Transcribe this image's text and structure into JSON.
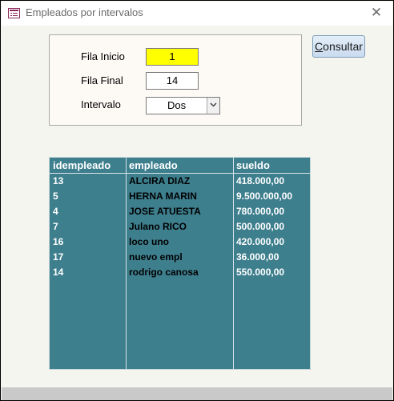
{
  "window": {
    "title": "Empleados por intervalos"
  },
  "form": {
    "fila_inicio_label": "Fila Inicio",
    "fila_inicio_value": "1",
    "fila_final_label": "Fila Final",
    "fila_final_value": "14",
    "intervalo_label": "Intervalo",
    "intervalo_value": "Dos"
  },
  "consultar_button": {
    "accel": "C",
    "rest": "onsultar"
  },
  "table": {
    "headers": [
      "idempleado",
      "empleado",
      "sueldo"
    ],
    "rows": [
      [
        "13",
        "ALCIRA DIAZ",
        "418.000,00"
      ],
      [
        "5",
        "HERNA MARIN",
        "9.500.000,00"
      ],
      [
        "4",
        "JOSE ATUESTA",
        "780.000,00"
      ],
      [
        "7",
        "Julano RICO",
        "500.000,00"
      ],
      [
        "16",
        "loco uno",
        "420.000,00"
      ],
      [
        "17",
        "nuevo empl",
        "36.000,00"
      ],
      [
        "14",
        "rodrigo canosa",
        "550.000,00"
      ]
    ]
  },
  "colors": {
    "highlight_field": "#ffff00",
    "grid_background": "#3e7f8e"
  }
}
